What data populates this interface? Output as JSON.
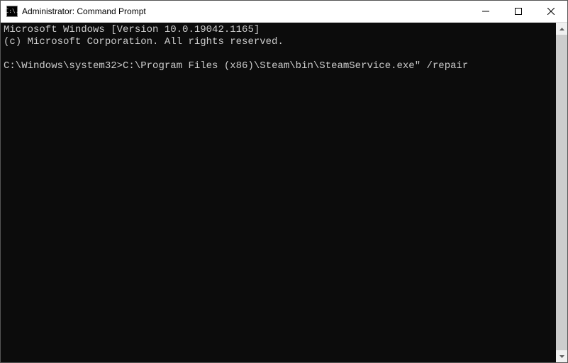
{
  "window": {
    "title": "Administrator: Command Prompt",
    "icon_text": "C:\\."
  },
  "terminal": {
    "line1": "Microsoft Windows [Version 10.0.19042.1165]",
    "line2": "(c) Microsoft Corporation. All rights reserved.",
    "prompt": "C:\\Windows\\system32>",
    "command": "C:\\Program Files (x86)\\Steam\\bin\\SteamService.exe\" /repair"
  }
}
